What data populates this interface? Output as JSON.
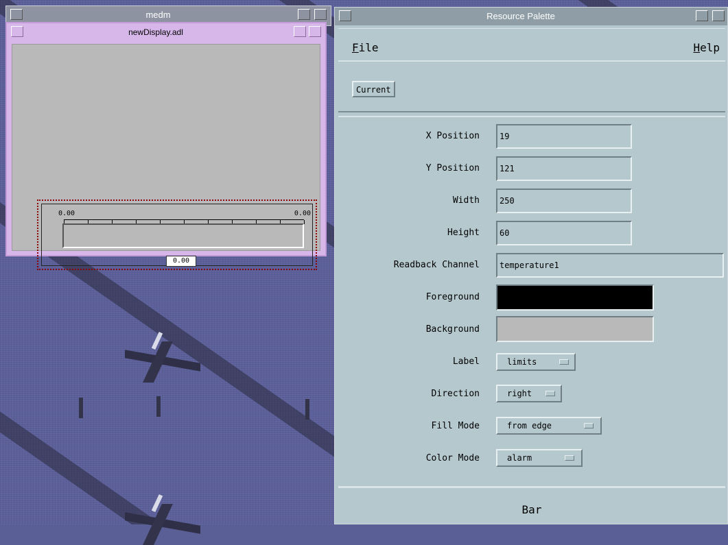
{
  "medm_window": {
    "title": "medm"
  },
  "display_window": {
    "title": "newDisplay.adl",
    "bar": {
      "low_limit": "0.00",
      "high_limit": "0.00",
      "readback": "0.00"
    }
  },
  "palette": {
    "title": "Resource Palette",
    "menu": {
      "file": "File",
      "help": "Help"
    },
    "current_button": "Current",
    "fields": {
      "x_position": {
        "label": "X Position",
        "value": "19"
      },
      "y_position": {
        "label": "Y Position",
        "value": "121"
      },
      "width": {
        "label": "Width",
        "value": "250"
      },
      "height": {
        "label": "Height",
        "value": "60"
      },
      "readback_channel": {
        "label": "Readback Channel",
        "value": "temperature1"
      },
      "foreground": {
        "label": "Foreground",
        "color": "#000000"
      },
      "background": {
        "label": "Background",
        "color": "#b9b9b9"
      },
      "label_opt": {
        "label": "Label",
        "value": "limits"
      },
      "direction": {
        "label": "Direction",
        "value": "right"
      },
      "fill_mode": {
        "label": "Fill Mode",
        "value": "from edge"
      },
      "color_mode": {
        "label": "Color Mode",
        "value": "alarm"
      }
    },
    "footer": "Bar"
  }
}
